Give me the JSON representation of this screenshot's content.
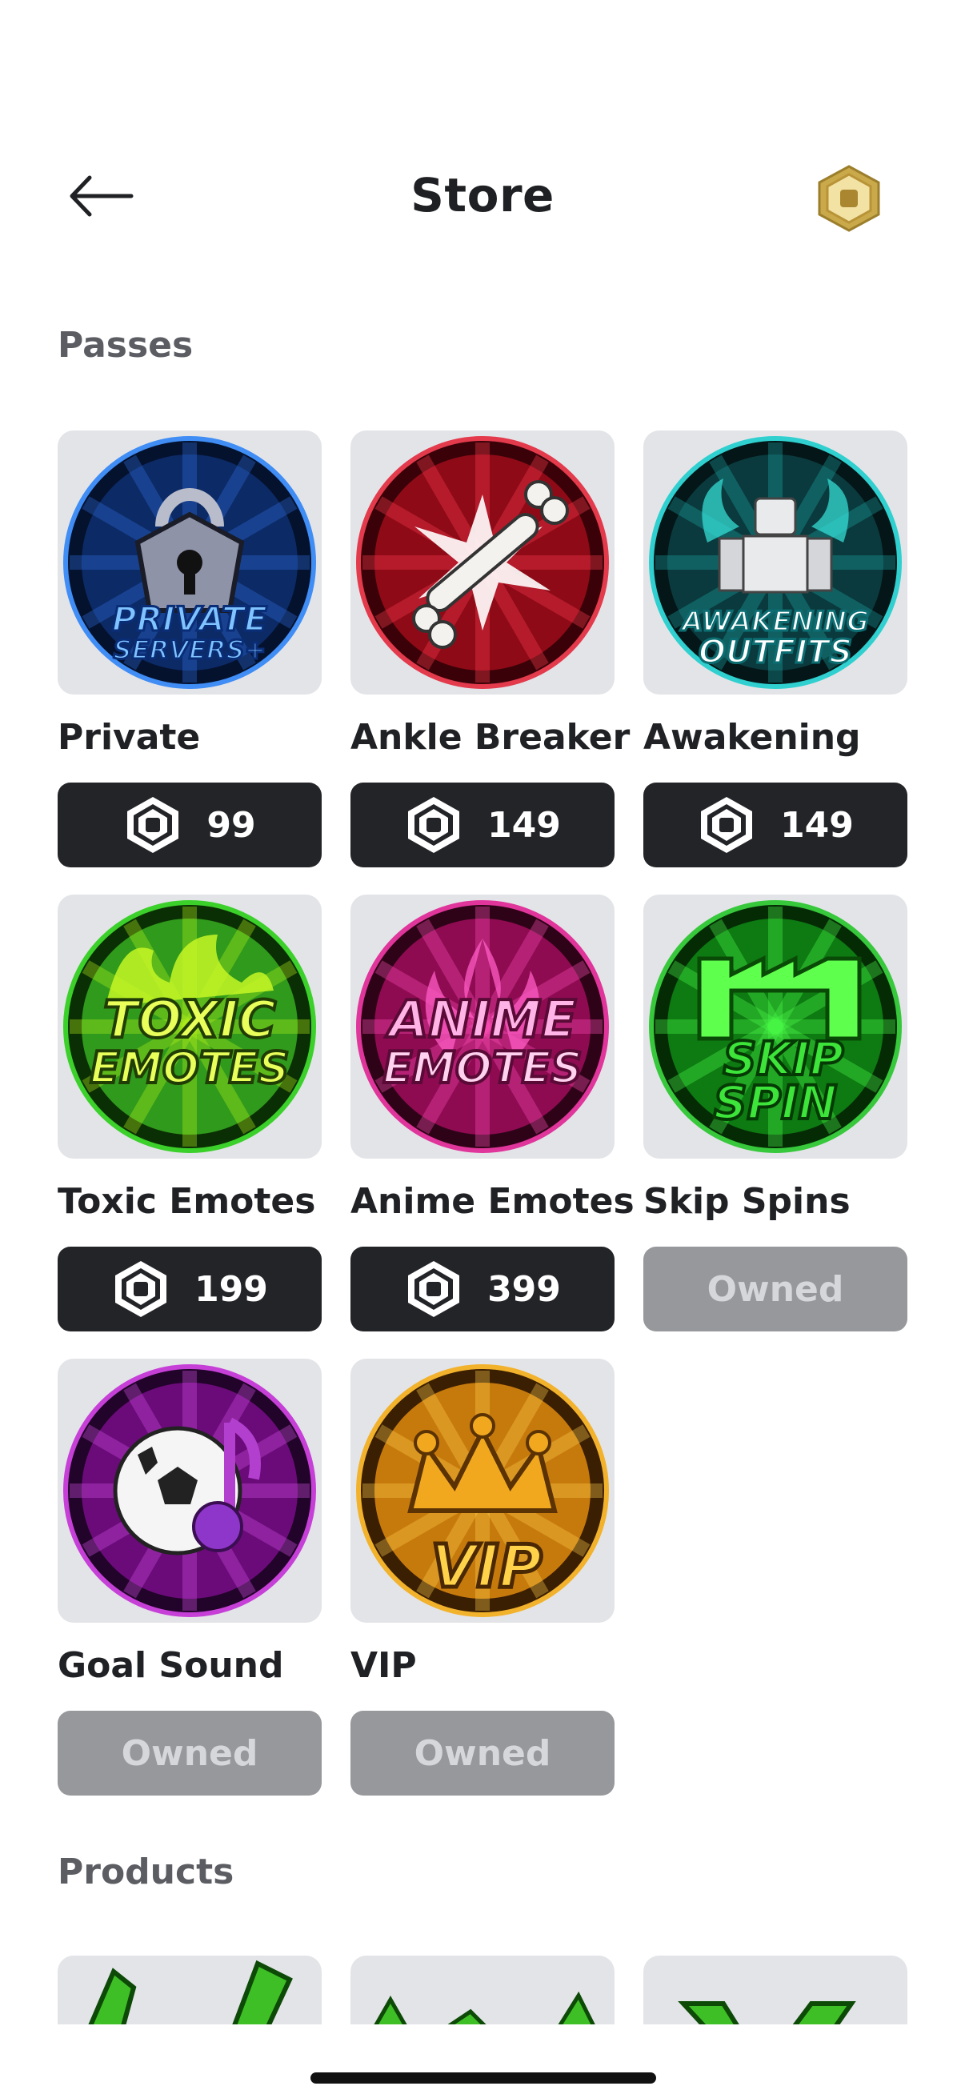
{
  "header": {
    "title": "Store"
  },
  "sections": {
    "passes": "Passes",
    "products": "Products"
  },
  "passes": [
    {
      "name": "Private",
      "price": "99",
      "owned": false,
      "art": "private-servers",
      "art_text": [
        "PRIVATE",
        "SERVERS+"
      ]
    },
    {
      "name": "Ankle Breaker",
      "price": "149",
      "owned": false,
      "art": "ankle-breaker",
      "art_text": []
    },
    {
      "name": "Awakening",
      "price": "149",
      "owned": false,
      "art": "awakening",
      "art_text": [
        "AWAKENING",
        "OUTFITS"
      ]
    },
    {
      "name": "Toxic Emotes",
      "price": "199",
      "owned": false,
      "art": "toxic-emotes",
      "art_text": [
        "TOXIC",
        "EMOTES"
      ]
    },
    {
      "name": "Anime Emotes",
      "price": "399",
      "owned": false,
      "art": "anime-emotes",
      "art_text": [
        "ANIME",
        "EMOTES"
      ]
    },
    {
      "name": "Skip Spins",
      "price": "Owned",
      "owned": true,
      "art": "skip-spin",
      "art_text": [
        "SKIP",
        "SPIN"
      ]
    },
    {
      "name": "Goal Sound",
      "price": "Owned",
      "owned": true,
      "art": "goal-sound",
      "art_text": []
    },
    {
      "name": "VIP",
      "price": "Owned",
      "owned": true,
      "art": "vip",
      "art_text": [
        "VIP"
      ]
    }
  ],
  "colors": {
    "button_dark": "#232428",
    "button_owned": "#97989c",
    "card_bg": "#e3e4e8",
    "robux_gold": "#c9a94a"
  },
  "icons": {
    "back": "arrow-left-icon",
    "robux": "robux-icon"
  }
}
